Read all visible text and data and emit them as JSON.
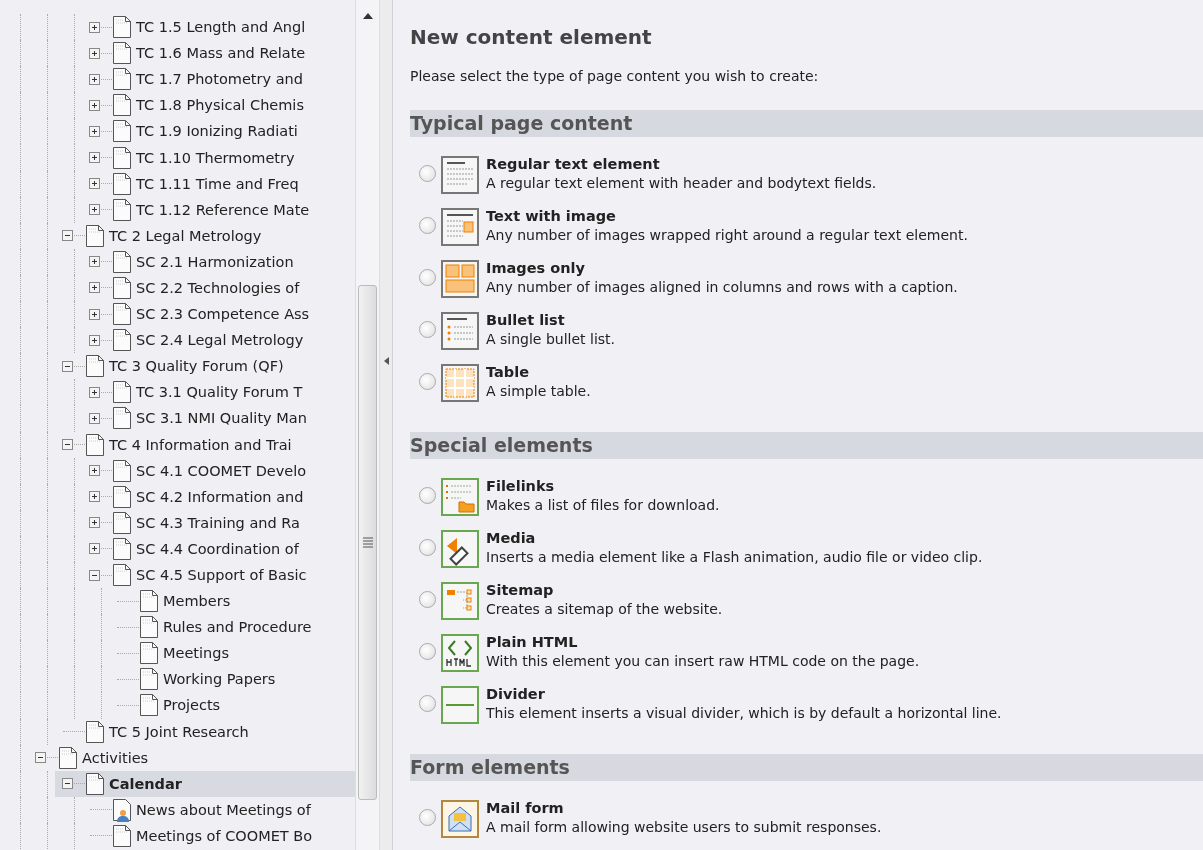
{
  "page_tree": [
    {
      "children": [
        {
          "children": [
            {
              "label": "TC 1.5 Length and Angl",
              "kind": "page",
              "expanded": false,
              "selected": false
            },
            {
              "label": "TC 1.6 Mass and Relate",
              "kind": "page",
              "expanded": false,
              "selected": false
            },
            {
              "label": "TC 1.7 Photometry and",
              "kind": "page",
              "expanded": false,
              "selected": false
            },
            {
              "label": "TC 1.8 Physical Chemis",
              "kind": "page",
              "expanded": false,
              "selected": false
            },
            {
              "label": "TC 1.9 Ionizing Radiati",
              "kind": "page",
              "expanded": false,
              "selected": false
            },
            {
              "label": "TC 1.10 Thermometry",
              "kind": "page",
              "expanded": false,
              "selected": false
            },
            {
              "label": "TC 1.11 Time and Freq",
              "kind": "page",
              "expanded": false,
              "selected": false
            },
            {
              "label": "TC 1.12 Reference Mate",
              "kind": "page",
              "expanded": false,
              "selected": false
            }
          ]
        },
        {
          "label": "TC 2 Legal Metrology",
          "kind": "page",
          "expanded": true,
          "selected": false,
          "children": [
            {
              "label": "SC 2.1 Harmonization",
              "kind": "page",
              "expanded": false,
              "selected": false
            },
            {
              "label": "SC 2.2 Technologies of",
              "kind": "page",
              "expanded": false,
              "selected": false
            },
            {
              "label": "SC 2.3 Competence Ass",
              "kind": "page",
              "expanded": false,
              "selected": false
            },
            {
              "label": "SC 2.4 Legal Metrology",
              "kind": "page",
              "expanded": false,
              "selected": false
            }
          ]
        },
        {
          "label": "TC 3 Quality Forum (QF)",
          "kind": "page",
          "expanded": true,
          "selected": false,
          "children": [
            {
              "label": "TC 3.1 Quality Forum T",
              "kind": "page",
              "expanded": false,
              "selected": false
            },
            {
              "label": "SC 3.1 NMI Quality Man",
              "kind": "page",
              "expanded": false,
              "selected": false
            }
          ]
        },
        {
          "label": "TC 4 Information and Trai",
          "kind": "page",
          "expanded": true,
          "selected": false,
          "children": [
            {
              "label": "SC 4.1 COOMET Develo",
              "kind": "page",
              "expanded": false,
              "selected": false
            },
            {
              "label": "SC 4.2 Information and",
              "kind": "page",
              "expanded": false,
              "selected": false
            },
            {
              "label": "SC 4.3 Training and Ra",
              "kind": "page",
              "expanded": false,
              "selected": false
            },
            {
              "label": "SC 4.4 Coordination of",
              "kind": "page",
              "expanded": false,
              "selected": false
            },
            {
              "label": "SC 4.5 Support of Basic",
              "kind": "page",
              "expanded": true,
              "selected": false,
              "children": [
                {
                  "label": "Members",
                  "kind": "page",
                  "selected": false
                },
                {
                  "label": "Rules and Procedure",
                  "kind": "page",
                  "selected": false
                },
                {
                  "label": "Meetings",
                  "kind": "page",
                  "selected": false
                },
                {
                  "label": "Working Papers",
                  "kind": "page",
                  "selected": false
                },
                {
                  "label": "Projects",
                  "kind": "page",
                  "selected": false
                }
              ]
            }
          ]
        },
        {
          "label": "TC 5 Joint Research",
          "kind": "page",
          "selected": false
        }
      ]
    },
    {
      "label": "Activities",
      "kind": "page",
      "expanded": true,
      "selected": false,
      "children": [
        {
          "label": "Calendar",
          "kind": "page",
          "expanded": true,
          "selected": true,
          "children": [
            {
              "label": "News about Meetings of",
              "kind": "user_page",
              "selected": false
            },
            {
              "label": "Meetings of COOMET Bo",
              "kind": "page",
              "selected": false
            }
          ]
        }
      ]
    }
  ],
  "content": {
    "title": "New content element",
    "intro": "Please select the type of page content you wish to create:",
    "sections": [
      {
        "title": "Typical page content",
        "items": [
          {
            "kind": "text",
            "title": "Regular text element",
            "description": "A regular text element with header and bodytext fields.",
            "selected": false
          },
          {
            "kind": "textpic",
            "title": "Text with image",
            "description": "Any number of images wrapped right around a regular text element.",
            "selected": false
          },
          {
            "kind": "image",
            "title": "Images only",
            "description": "Any number of images aligned in columns and rows with a caption.",
            "selected": false
          },
          {
            "kind": "bullets",
            "title": "Bullet list",
            "description": "A single bullet list.",
            "selected": false
          },
          {
            "kind": "table",
            "title": "Table",
            "description": "A simple table.",
            "selected": false
          }
        ]
      },
      {
        "title": "Special elements",
        "items": [
          {
            "kind": "uploads",
            "title": "Filelinks",
            "description": "Makes a list of files for download.",
            "selected": false
          },
          {
            "kind": "media",
            "title": "Media",
            "description": "Inserts a media element like a Flash animation, audio file or video clip.",
            "selected": false
          },
          {
            "kind": "menu",
            "title": "Sitemap",
            "description": "Creates a sitemap of the website.",
            "selected": false
          },
          {
            "kind": "html",
            "title": "Plain HTML",
            "description": "With this element you can insert raw HTML code on the page.",
            "selected": false
          },
          {
            "kind": "div",
            "title": "Divider",
            "description": "This element inserts a visual divider, which is by default a horizontal line.",
            "selected": false
          }
        ]
      },
      {
        "title": "Form elements",
        "items": [
          {
            "kind": "mailform",
            "title": "Mail form",
            "description": "A mail form allowing website users to submit responses.",
            "selected": false
          }
        ]
      }
    ]
  }
}
